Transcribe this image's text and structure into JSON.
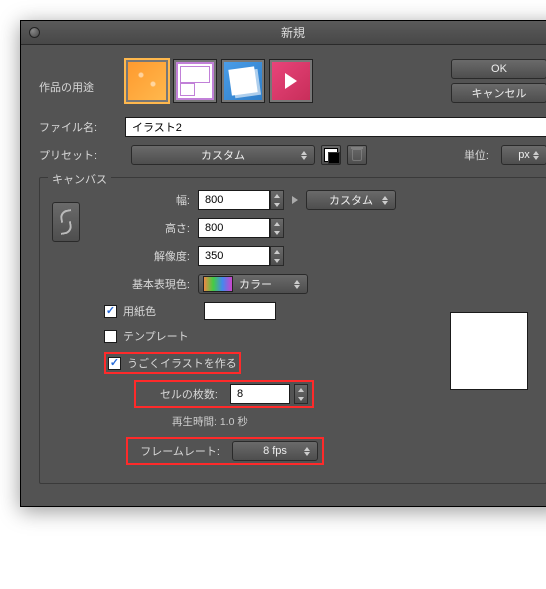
{
  "dialog_title": "新規",
  "purpose_label": "作品の用途",
  "buttons": {
    "ok": "OK",
    "cancel": "キャンセル"
  },
  "filename": {
    "label": "ファイル名:",
    "value": "イラスト2"
  },
  "preset": {
    "label": "プリセット:",
    "value": "カスタム"
  },
  "unit": {
    "label": "単位:",
    "value": "px"
  },
  "canvas": {
    "legend": "キャンバス",
    "width": {
      "label": "幅:",
      "value": "800"
    },
    "height": {
      "label": "高さ:",
      "value": "800"
    },
    "resolution": {
      "label": "解像度:",
      "value": "350"
    },
    "color_mode": {
      "label": "基本表現色:",
      "value": "カラー"
    },
    "size_preset": "カスタム"
  },
  "paper_color": {
    "label": "用紙色",
    "checked": true
  },
  "template": {
    "label": "テンプレート",
    "checked": false
  },
  "animation": {
    "make_label": "うごくイラストを作る",
    "checked": true,
    "cells": {
      "label": "セルの枚数:",
      "value": "8"
    },
    "playback": "再生時間: 1.0 秒",
    "framerate": {
      "label": "フレームレート:",
      "value": "8 fps"
    }
  }
}
